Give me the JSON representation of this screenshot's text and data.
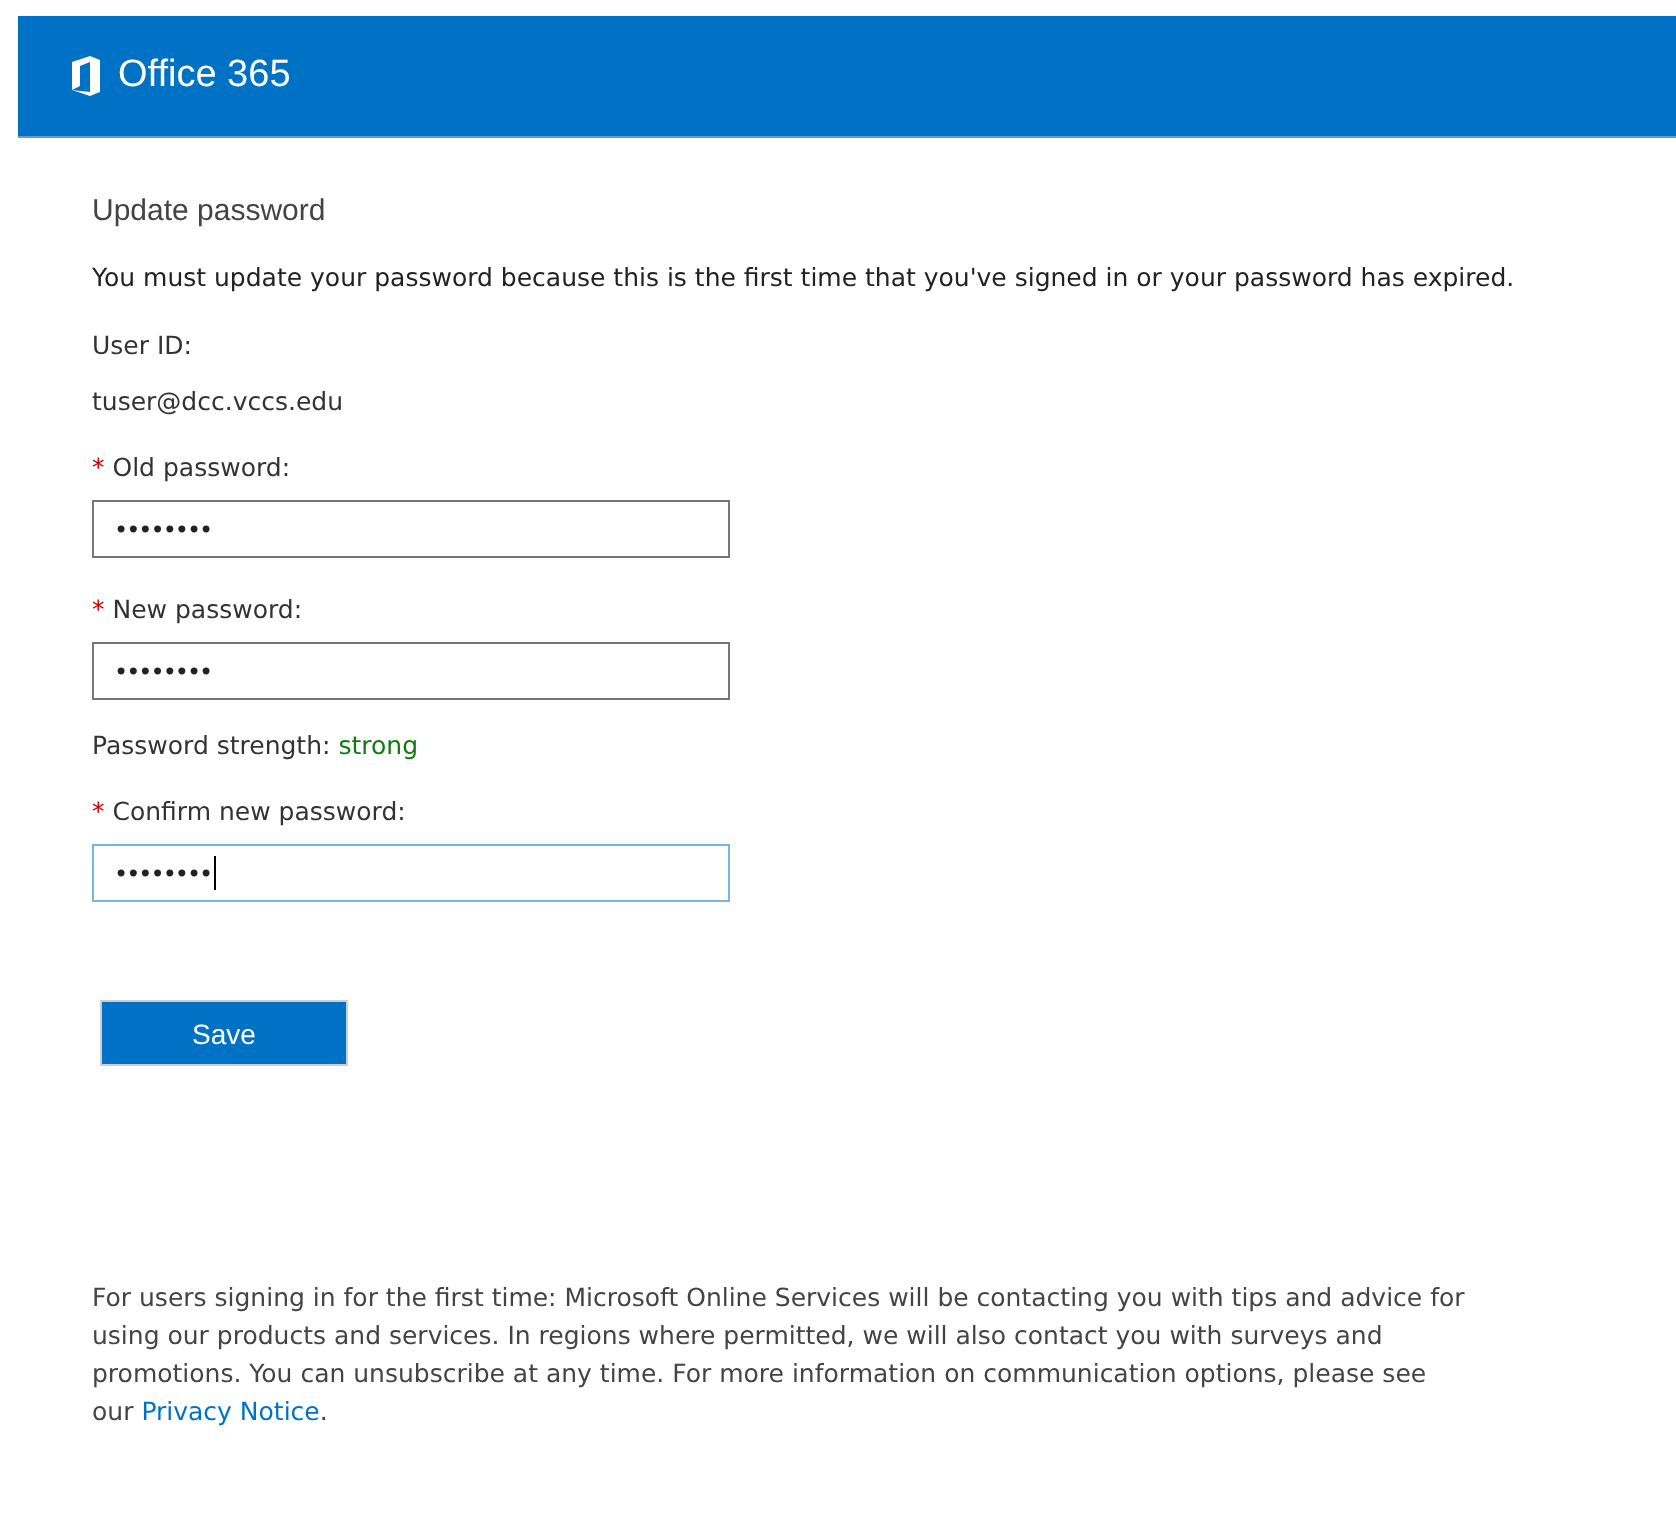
{
  "header": {
    "title": "Office 365"
  },
  "form": {
    "title": "Update password",
    "intro": "You must update your password because this is the first time that you've signed in or your password has expired.",
    "user_id_label": "User ID:",
    "user_id": "tuser@dcc.vccs.edu",
    "fields": [
      {
        "kind": "password",
        "required_mark": "*",
        "label": "Old password:",
        "value": "••••••••",
        "focused": false
      },
      {
        "kind": "password",
        "required_mark": "*",
        "label": "New password:",
        "value": "••••••••",
        "focused": false
      },
      {
        "kind": "strength",
        "label": "Password strength:",
        "value": "strong",
        "color": "#107c10"
      },
      {
        "kind": "password",
        "required_mark": "*",
        "label": "Confirm new password:",
        "value": "••••••••",
        "focused": true
      }
    ],
    "save_button": "Save"
  },
  "footer": {
    "text": "For users signing in for the first time: Microsoft Online Services will be contacting you with tips and advice for using our products and services. In regions where permitted, we will also contact you with surveys and promotions. You can unsubscribe at any time. For more information on communication options, please see our ",
    "link": "Privacy Notice",
    "end": "."
  }
}
